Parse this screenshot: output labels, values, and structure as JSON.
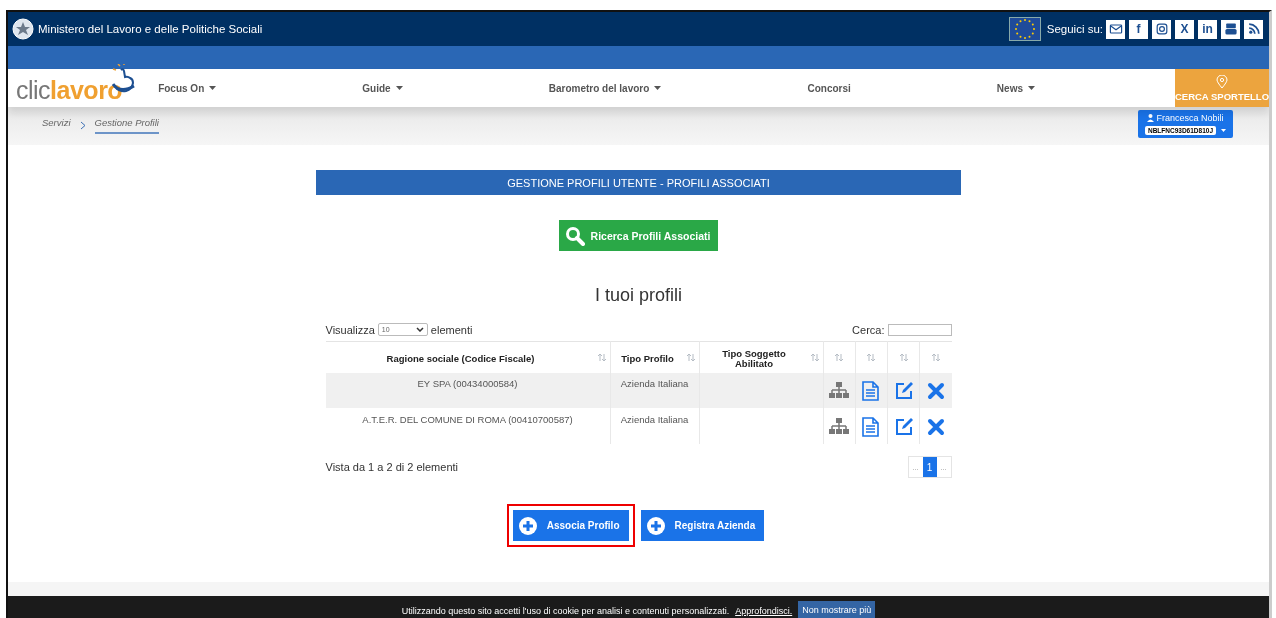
{
  "top_bar": {
    "title": "Ministero del Lavoro e delle Politiche Sociali",
    "follow_label": "Seguici su:",
    "social": [
      {
        "kind": "mail"
      },
      {
        "kind": "text",
        "text": "f"
      },
      {
        "kind": "instagram"
      },
      {
        "kind": "text",
        "text": "X"
      },
      {
        "kind": "text",
        "text": "in"
      },
      {
        "kind": "youtube"
      },
      {
        "kind": "rss"
      }
    ]
  },
  "logo": {
    "part_1": "clic",
    "part_2": "lavoro"
  },
  "nav": [
    {
      "label": "Focus On",
      "dropdown": true
    },
    {
      "label": "Guide",
      "dropdown": true
    },
    {
      "label": "Barometro del lavoro",
      "dropdown": true
    },
    {
      "label": "Concorsi",
      "dropdown": false
    },
    {
      "label": "News",
      "dropdown": true
    }
  ],
  "cta": {
    "label": "CERCA SPORTELLO"
  },
  "breadcrumb": [
    {
      "label": "Servizi",
      "current": false
    },
    {
      "label": "Gestione Profili",
      "current": true
    }
  ],
  "user": {
    "name": "Francesca Nobili",
    "code": "NBLFNC93D61D810J"
  },
  "panel_title": "GESTIONE PROFILI UTENTE - PROFILI ASSOCIATI",
  "search_button": {
    "label": "Ricerca Profili Associati"
  },
  "section_title": "I tuoi profili",
  "table": {
    "length_prefix": "Visualizza",
    "length_value": "10",
    "length_suffix": "elementi",
    "search_label": "Cerca:",
    "columns": [
      {
        "label": "Ragione sociale (Codice Fiscale)"
      },
      {
        "label": "Tipo Profilo"
      },
      {
        "label": "Tipo Soggetto Abilitato"
      },
      {
        "kind": "icon"
      },
      {
        "kind": "icon"
      },
      {
        "kind": "icon"
      },
      {
        "kind": "icon"
      }
    ],
    "rows": [
      {
        "name": "EY SPA (00434000584)",
        "type": "Azienda Italiana",
        "subject": "",
        "striped": true
      },
      {
        "name": "A.T.E.R. DEL COMUNE DI ROMA (00410700587)",
        "type": "Azienda Italiana",
        "subject": "",
        "striped": false
      }
    ],
    "info": "Vista da 1 a 2 di 2 elementi",
    "pages": [
      {
        "label": "...",
        "selected": false
      },
      {
        "label": "1",
        "selected": true
      },
      {
        "label": "...",
        "selected": false
      }
    ]
  },
  "actions": [
    {
      "label": "Associa Profilo",
      "highlighted": true
    },
    {
      "label": "Registra Azienda",
      "highlighted": false
    }
  ],
  "cookie": {
    "text": "Utilizzando questo sito accetti l'uso di cookie per analisi e contenuti personalizzati.",
    "link": "Approfondisci.",
    "button": "Non mostrare più"
  }
}
